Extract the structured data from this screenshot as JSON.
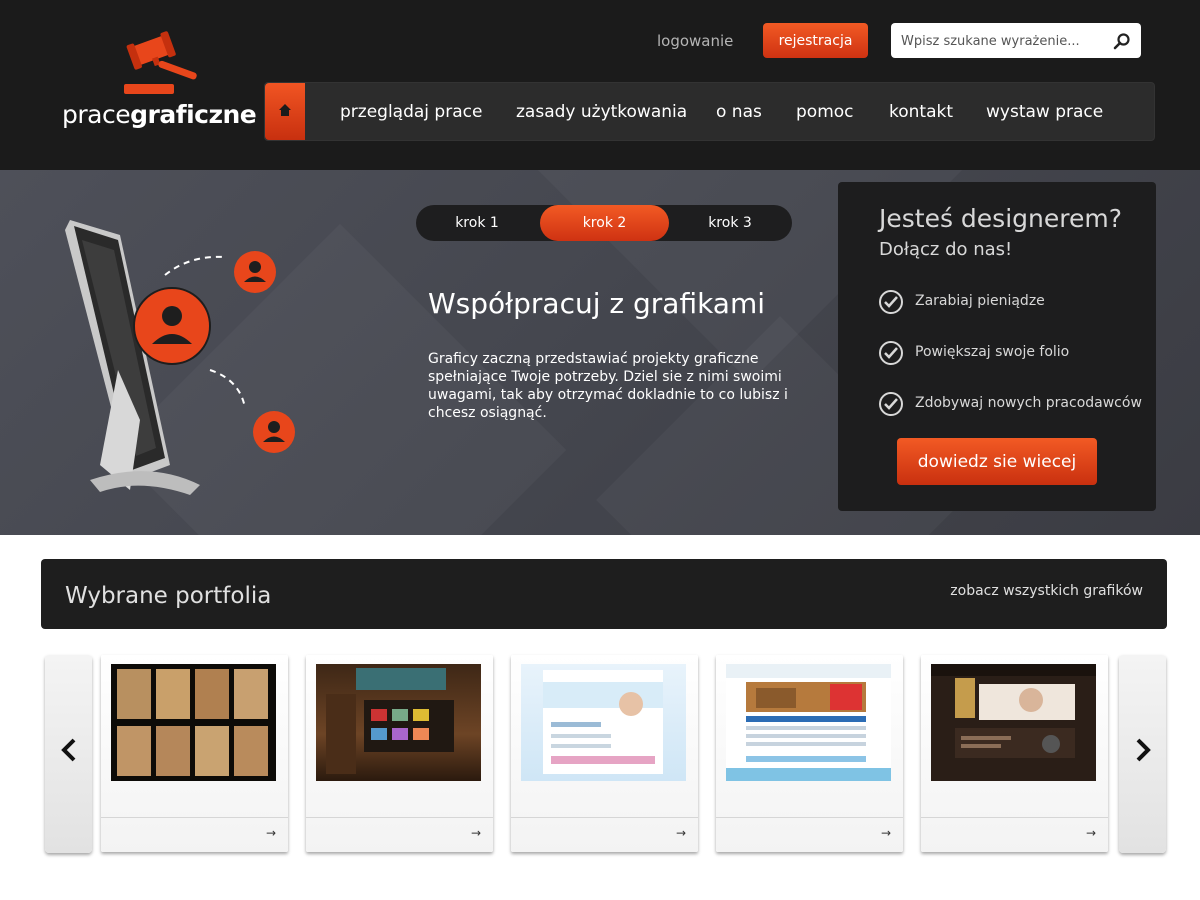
{
  "brand": {
    "logo_text_light": "prace",
    "logo_text_bold": "graficzne",
    "accent": "#e8461b",
    "dark": "#1b1b1b"
  },
  "header": {
    "login": "logowanie",
    "register": "rejestracja",
    "search_placeholder": "Wpisz szukane wyrażenie..."
  },
  "nav": {
    "home_icon": "home-icon",
    "items": [
      "przeglądaj prace",
      "zasady użytkowania",
      "o nas",
      "pomoc",
      "kontakt",
      "wystaw prace"
    ]
  },
  "hero": {
    "steps": [
      "krok 1",
      "krok 2",
      "krok 3"
    ],
    "active_step": "krok 2",
    "title": "Współpracuj z grafikami",
    "text": "Graficy zaczną przedstawiać projekty graficzne spełniające Twoje potrzeby. Dziel sie z nimi swoimi uwagami, tak aby otrzymać dokladnie to co lubisz i chcesz osiągnąć."
  },
  "join": {
    "title": "Jesteś designerem?",
    "subtitle": "Dołącz do nas!",
    "benefits": [
      "Zarabiaj pieniądze",
      "Powiększaj swoje folio",
      "Zdobywaj nowych pracodawców"
    ],
    "button": "dowiedz sie wiecej"
  },
  "portfolio": {
    "title": "Wybrane portfolia",
    "see_all": "zobacz wszystkich grafików",
    "cards": [
      {
        "arrow": "→"
      },
      {
        "arrow": "→"
      },
      {
        "arrow": "→"
      },
      {
        "arrow": "→"
      },
      {
        "arrow": "→"
      }
    ]
  }
}
